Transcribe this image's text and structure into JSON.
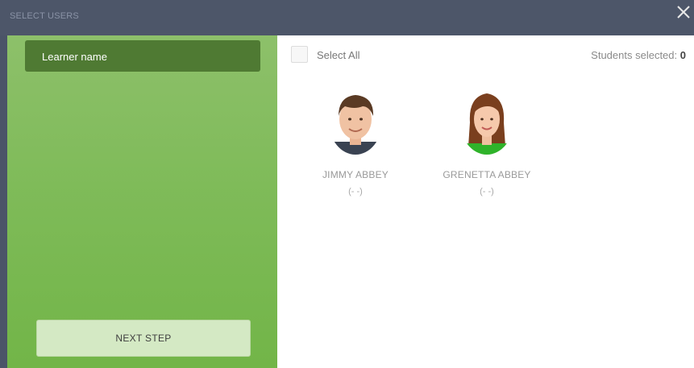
{
  "header": {
    "title": "SELECT USERS",
    "faint_label": "",
    "background_text": "",
    "close_icon": "close-icon"
  },
  "sidebar": {
    "learner_label": "Learner name",
    "next_step_label": "NEXT STEP",
    "colors": {
      "panel": "#7fbb59",
      "button": "#4f7a33",
      "next": "#d4e9c4"
    }
  },
  "selection": {
    "select_all_label": "Select All",
    "students_selected_label": "Students selected:",
    "students_selected_count": "0"
  },
  "students": [
    {
      "name": "JIMMY ABBEY",
      "detail": "(- -)",
      "avatar": "boy-avatar-icon"
    },
    {
      "name": "GRENETTA ABBEY",
      "detail": "(- -)",
      "avatar": "girl-avatar-icon"
    }
  ]
}
